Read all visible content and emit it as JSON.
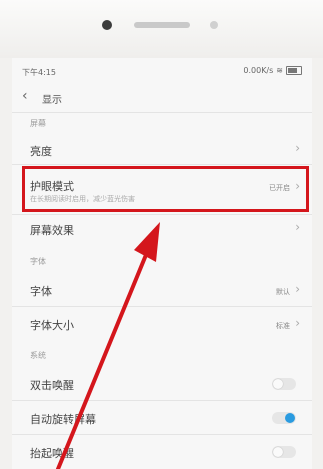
{
  "status_bar": {
    "time": "下午4:15",
    "speed": "0.00K/s"
  },
  "header": {
    "title": "显示"
  },
  "sections": {
    "screen": "屏幕",
    "font": "字体",
    "system": "系统"
  },
  "rows": {
    "brightness": {
      "label": "亮度"
    },
    "eye_protection": {
      "label": "护眼模式",
      "subtitle": "在长期阅读时启用，减少蓝光伤害",
      "value": "已开启"
    },
    "screen_effect": {
      "label": "屏幕效果"
    },
    "font": {
      "label": "字体",
      "value": "默认"
    },
    "font_size": {
      "label": "字体大小",
      "value": "标准"
    },
    "double_tap_wake": {
      "label": "双击唤醒",
      "on": false
    },
    "auto_rotate": {
      "label": "自动旋转屏幕",
      "on": true
    },
    "raise_to_wake": {
      "label": "抬起唤醒",
      "on": false
    }
  },
  "colors": {
    "annotation_red": "#d4161c",
    "toggle_on": "#2a9be0"
  }
}
